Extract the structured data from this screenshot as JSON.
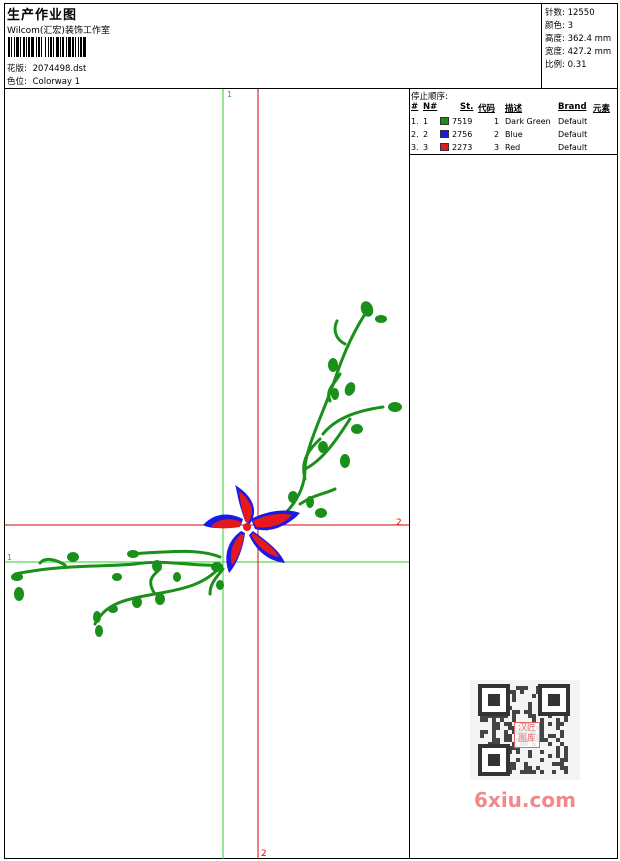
{
  "header": {
    "title": "生产作业图",
    "company": "Wilcom(汇宏)装饰工作室",
    "design_label": "花版:",
    "design_file": "2074498.dst",
    "colorway_label": "色位:",
    "colorway": "Colorway 1"
  },
  "stats": [
    {
      "label": "针数:",
      "value": "12550"
    },
    {
      "label": "颜色:",
      "value": "3"
    },
    {
      "label": "高度:",
      "value": "362.4 mm"
    },
    {
      "label": "宽度:",
      "value": "427.2 mm"
    },
    {
      "label": "比例:",
      "value": "0.31"
    }
  ],
  "stop_sequence": {
    "title": "停止顺序:",
    "columns": [
      "#",
      "N#",
      "St.",
      "代码",
      "描述",
      "Brand",
      "元素"
    ],
    "rows": [
      {
        "num": "1.",
        "n": "1",
        "st": "7519",
        "code": "1",
        "desc": "Dark Green",
        "brand": "Default",
        "color": "#1a8f1a"
      },
      {
        "num": "2.",
        "n": "2",
        "st": "2756",
        "code": "2",
        "desc": "Blue",
        "brand": "Default",
        "color": "#1a1ae6"
      },
      {
        "num": "3.",
        "n": "3",
        "st": "2273",
        "code": "3",
        "desc": "Red",
        "brand": "Default",
        "color": "#e61a1a"
      }
    ]
  },
  "guides": {
    "green_label_top": "1",
    "green_label_left": "1",
    "red_label_right": "2",
    "red_label_bottom": "2"
  },
  "watermark": {
    "site": "6xiu.com",
    "seal": "汉匠图库"
  },
  "colors": {
    "green": "#1a8f1a",
    "blue": "#1a1ae6",
    "red": "#e61a1a",
    "guide_green": "#33cc33",
    "guide_red": "#dd0000"
  }
}
